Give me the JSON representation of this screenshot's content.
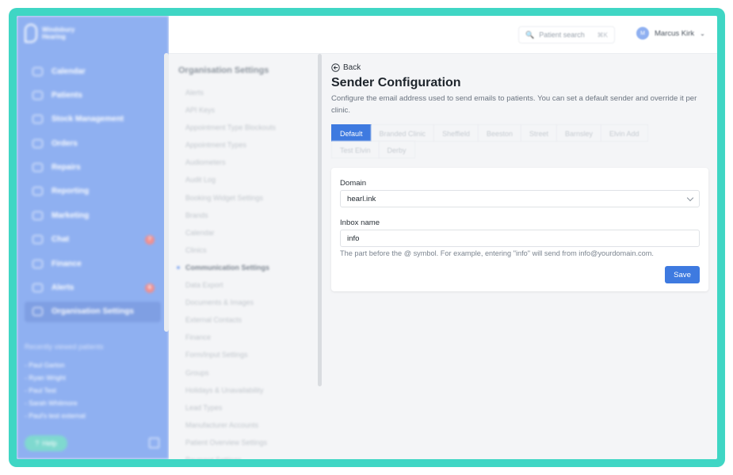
{
  "app": {
    "logo_text": "Windsbury Hearing"
  },
  "sidebar": {
    "items": [
      {
        "label": "Calendar",
        "icon": "calendar-icon"
      },
      {
        "label": "Patients",
        "icon": "patients-icon"
      },
      {
        "label": "Stock Management",
        "icon": "stock-icon"
      },
      {
        "label": "Orders",
        "icon": "orders-icon"
      },
      {
        "label": "Repairs",
        "icon": "wrench-icon"
      },
      {
        "label": "Reporting",
        "icon": "chart-icon"
      },
      {
        "label": "Marketing",
        "icon": "mail-icon"
      },
      {
        "label": "Chat",
        "icon": "chat-icon",
        "badge": "7"
      },
      {
        "label": "Finance",
        "icon": "card-icon"
      },
      {
        "label": "Alerts",
        "icon": "bell-icon",
        "badge": "6"
      },
      {
        "label": "Organisation Settings",
        "icon": "gear-icon",
        "active": true
      }
    ],
    "recent_title": "Recently viewed patients",
    "recent": [
      "- Paul Garton",
      "- Ryan Wright",
      "- Paul Test",
      "- Sarah Whitmore",
      "- Paul's test external"
    ],
    "help_label": "Help"
  },
  "topbar": {
    "search_label": "Patient search",
    "search_shortcut": "⌘K",
    "user_name": "Marcus Kirk",
    "user_initials": "M"
  },
  "settings_nav": {
    "title": "Organisation Settings",
    "items": [
      "Alerts",
      "API Keys",
      "Appointment Type Blockouts",
      "Appointment Types",
      "Audiometers",
      "Audit Log",
      "Booking Widget Settings",
      "Brands",
      "Calendar",
      "Clinics",
      "Communication Settings",
      "Data Export",
      "Documents & Images",
      "External Contacts",
      "Finance",
      "Form/Input Settings",
      "Groups",
      "Holidays & Unavailability",
      "Lead Types",
      "Manufacturer Accounts",
      "Patient Overview Settings",
      "Payment Settings"
    ],
    "current": "Communication Settings"
  },
  "main": {
    "back_label": "Back",
    "title": "Sender Configuration",
    "description": "Configure the email address used to send emails to patients. You can set a default sender and override it per clinic.",
    "tabs": [
      "Default",
      "Branded Clinic",
      "Sheffield",
      "Beeston",
      "Street",
      "Barnsley",
      "Elvin Add",
      "Test Elvin",
      "Derby"
    ],
    "active_tab": "Default",
    "domain_label": "Domain",
    "domain_value": "hearl.ink",
    "inbox_label": "Inbox name",
    "inbox_value": "info",
    "hint": "The part before the @ symbol. For example, entering \"info\" will send from info@yourdomain.com.",
    "save_label": "Save"
  },
  "colors": {
    "accent": "#3e7ae0",
    "sidebar": "#8fb0f1",
    "frame": "#3fd6c4"
  }
}
